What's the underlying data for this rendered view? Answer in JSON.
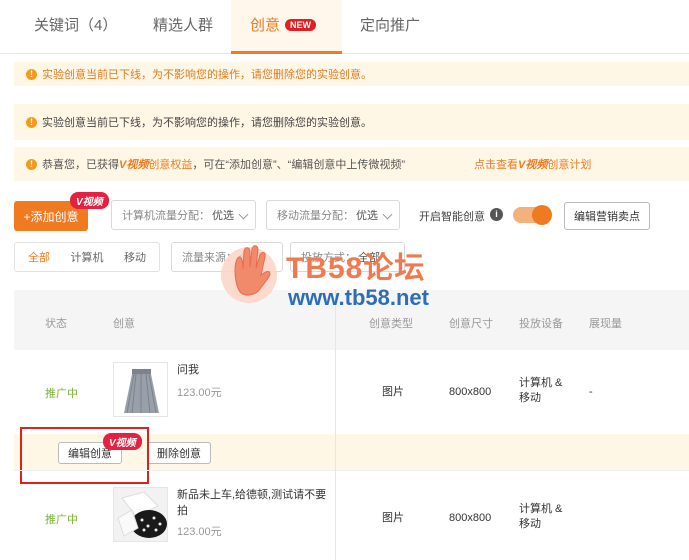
{
  "tabs": [
    {
      "label": "关键词（4）"
    },
    {
      "label": "精选人群"
    },
    {
      "label": "创意",
      "badge": "NEW"
    },
    {
      "label": "定向推广"
    }
  ],
  "notices": {
    "offline_1": "实验创意当前已下线，为不影响您的操作，请您删除您的实验创意。",
    "offline_2": "实验创意当前已下线，为不影响您的操作，请您删除您的实验创意。",
    "congrats_prefix": "恭喜您，已获得",
    "congrats_vbadge": "V视频",
    "congrats_rights": "创意权益",
    "congrats_suffix": "，可在“添加创意”、“编辑创意中上传微视频”",
    "link_prefix": "点击查看",
    "link_vbadge": "V视频",
    "link_suffix": "创意计划"
  },
  "toolbar": {
    "add_label": "+添加创意",
    "vbadge": "V视频",
    "pc_flow_label": "计算机流量分配：",
    "pc_flow_value": "优选",
    "mobile_flow_label": "移动流量分配：",
    "mobile_flow_value": "优选",
    "smart_label": "开启智能创意",
    "smart_on": true,
    "edit_selling_points": "编辑营销卖点"
  },
  "filters": {
    "device_tabs": [
      "全部",
      "计算机",
      "移动"
    ],
    "active_device": "全部",
    "flow_source_label": "流量来源：",
    "flow_source_value": "全部",
    "placement_label": "投放方式：",
    "placement_value": "全部"
  },
  "table": {
    "headers": [
      "状态",
      "创意",
      "创意类型",
      "创意尺寸",
      "投放设备",
      "展现量"
    ],
    "rows": [
      {
        "status": "推广中",
        "name": "问我",
        "price": "123.00元",
        "type": "图片",
        "size": "800x800",
        "device": "计算机 & 移动",
        "impressions": "-"
      },
      {
        "status": "推广中",
        "name": "新品未上车,给德顿,测试请不要拍",
        "price": "123.00元",
        "type": "图片",
        "size": "800x800",
        "device": "计算机 & 移动",
        "impressions": ""
      }
    ],
    "actions": {
      "edit": "编辑创意",
      "delete": "删除创意",
      "vbadge": "V视频"
    }
  },
  "watermark": {
    "title": "TB58论坛",
    "url": "www.tb58.net"
  },
  "colors": {
    "accent": "#f07a20",
    "status_green": "#7ab236",
    "notice_bg": "#fff7e6",
    "badge_red": "#e62040",
    "highlight_red": "#e0201c"
  }
}
